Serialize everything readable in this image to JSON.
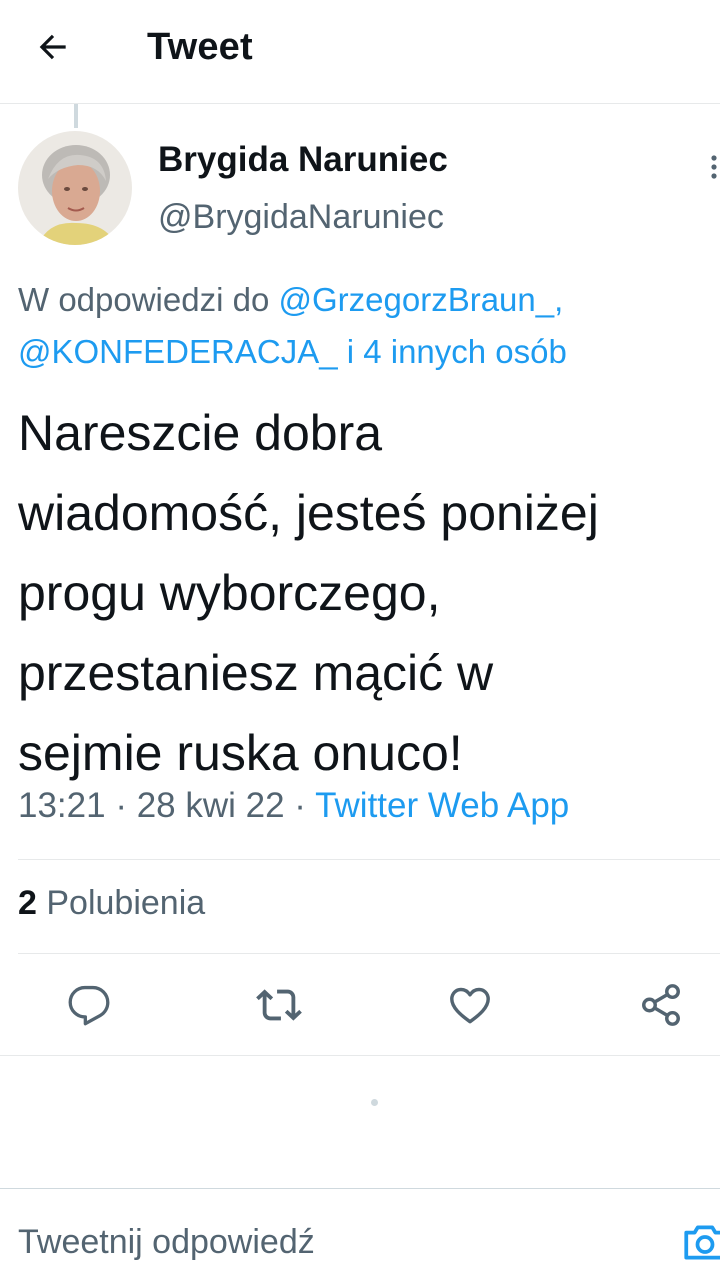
{
  "header": {
    "title": "Tweet",
    "back_icon": "arrow-left-icon"
  },
  "author": {
    "display_name": "Brygida Naruniec",
    "handle": "@BrygidaNaruniec"
  },
  "reply_to": {
    "prefix": "W odpowiedzi do ",
    "mention_1": "@GrzegorzBraun_,",
    "mention_2": "@KONFEDERACJA_",
    "suffix": " i 4 innych osób"
  },
  "tweet": {
    "line_1": "Nareszcie dobra",
    "line_2": "wiadomość, jesteś poniżej",
    "line_3": "progu wyborczego,",
    "line_4": "przestaniesz mącić w",
    "line_5": "sejmie ruska onuco!"
  },
  "meta": {
    "time": "13:21",
    "separator": " · ",
    "date": "28 kwi 22",
    "source": "Twitter Web App"
  },
  "stats": {
    "likes_count": "2",
    "likes_label": " Polubienia"
  },
  "actions": {
    "reply_icon": "reply-icon",
    "retweet_icon": "retweet-icon",
    "like_icon": "heart-icon",
    "share_icon": "share-icon"
  },
  "reply_bar": {
    "placeholder": "Tweetnij odpowiedź",
    "camera_icon": "camera-icon"
  },
  "colors": {
    "accent": "#1d9bf0",
    "text_primary": "#0f1419",
    "text_secondary": "#536471",
    "divider": "#e7e9ea"
  }
}
